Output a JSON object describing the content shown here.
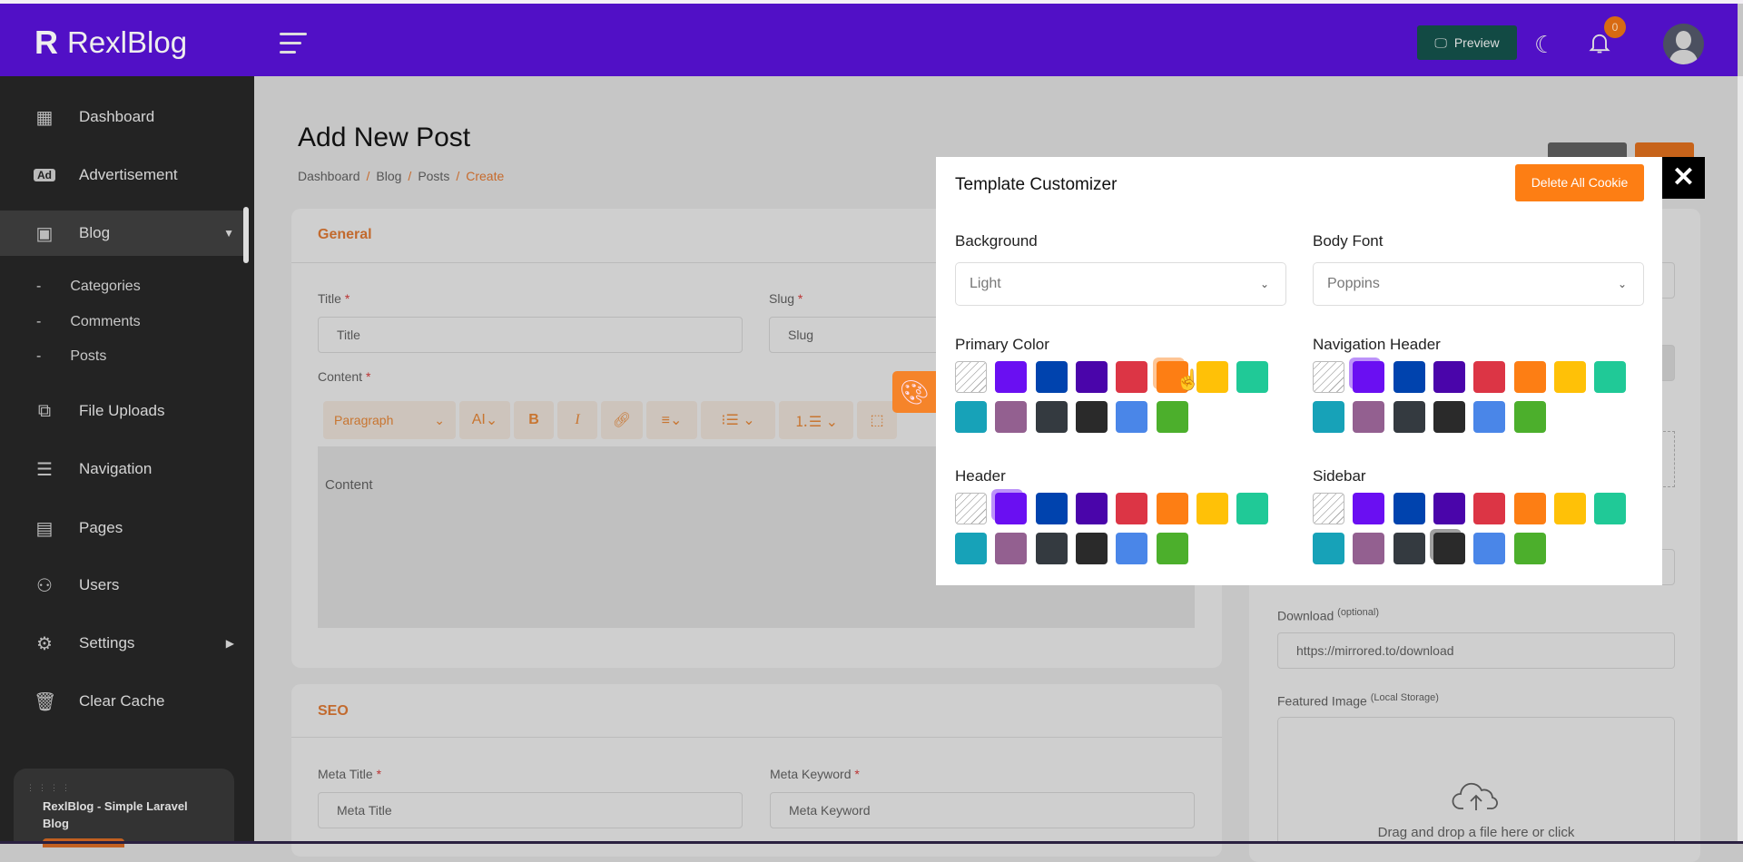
{
  "header": {
    "logo": "RexlBlog",
    "logo_mark": "R",
    "preview_label": "Preview",
    "notification_count": "0",
    "brand_color": "#5110c6"
  },
  "sidebar": {
    "items": [
      {
        "label": "Dashboard",
        "icon": "dashboard-icon",
        "glyph": "▦"
      },
      {
        "label": "Advertisement",
        "icon": "ad-icon",
        "glyph": "Ad"
      },
      {
        "label": "Blog",
        "icon": "blog-icon",
        "glyph": "▣",
        "expanded": true
      },
      {
        "label": "File Uploads",
        "icon": "file-icon",
        "glyph": "⧉"
      },
      {
        "label": "Navigation",
        "icon": "menu-icon",
        "glyph": "☰"
      },
      {
        "label": "Pages",
        "icon": "page-icon",
        "glyph": "▤"
      },
      {
        "label": "Users",
        "icon": "users-icon",
        "glyph": "⚇"
      },
      {
        "label": "Settings",
        "icon": "gear-icon",
        "glyph": "⚙"
      },
      {
        "label": "Clear Cache",
        "icon": "trash-icon",
        "glyph": "🗑"
      }
    ],
    "blog_sub": [
      "Categories",
      "Comments",
      "Posts"
    ],
    "sub_bullet": "-",
    "footer_card": "RexlBlog - Simple Laravel Blog"
  },
  "page": {
    "title": "Add New Post",
    "breadcrumb": [
      "Dashboard",
      "Blog",
      "Posts",
      "Create"
    ]
  },
  "general": {
    "heading": "General",
    "title_label": "Title",
    "title_placeholder": "Title",
    "slug_label": "Slug",
    "slug_placeholder": "Slug",
    "content_label": "Content",
    "content_placeholder": "Content",
    "toolbar": {
      "paragraph": "Paragraph",
      "font_size": "AI",
      "bold": "B",
      "italic": "I"
    }
  },
  "seo": {
    "heading": "SEO",
    "meta_title_label": "Meta Title",
    "meta_title_placeholder": "Meta Title",
    "meta_keyword_label": "Meta Keyword",
    "meta_keyword_placeholder": "Meta Keyword"
  },
  "right": {
    "download_label": "Download",
    "download_hint": "(optional)",
    "download_value": "https://mirrored.to/download",
    "featured_label": "Featured Image",
    "featured_hint": "(Local Storage)",
    "dropzone_text": "Drag and drop a file here or click"
  },
  "required_mark": "*",
  "customizer": {
    "title": "Template Customizer",
    "delete_label": "Delete All Cookie",
    "close": "✕",
    "background_label": "Background",
    "background_value": "Light",
    "font_label": "Body Font",
    "font_value": "Poppins",
    "swatches": [
      "none",
      "#6a0ff2",
      "#0043ae",
      "#4a05aa",
      "#dc3545",
      "#fd7e14",
      "#ffc107",
      "#20c997",
      "#17a2b8",
      "#936090",
      "#343a40",
      "#2a2a2a",
      "#4a86e8",
      "#4caf2c"
    ],
    "groups": [
      {
        "label": "Primary Color",
        "selected": 5
      },
      {
        "label": "Navigation Header",
        "selected": 1
      },
      {
        "label": "Header",
        "selected": 1
      },
      {
        "label": "Sidebar",
        "selected": 11
      }
    ]
  }
}
